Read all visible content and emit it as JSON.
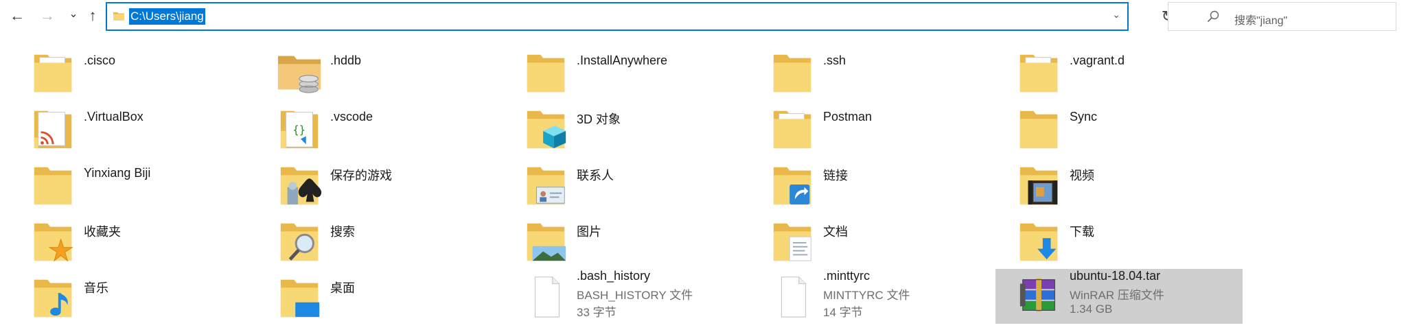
{
  "address": {
    "path": "C:\\Users\\jiang",
    "search_placeholder": "搜索\"jiang\""
  },
  "nav": {
    "back_glyph": "←",
    "forward_glyph": "→",
    "recent_glyph": "⌄",
    "up_glyph": "↑",
    "refresh_glyph": "↻",
    "dropdown_glyph": "⌄"
  },
  "colors": {
    "accent": "#0078d7",
    "folder": "#f8d775",
    "folder_dark": "#e8b84a",
    "selection": "#cfcfcf"
  },
  "items": [
    {
      "name": ".cisco",
      "icon": "folder-doc-icon"
    },
    {
      "name": ".hddb",
      "icon": "folder-database-icon"
    },
    {
      "name": ".InstallAnywhere",
      "icon": "folder-icon"
    },
    {
      "name": ".ssh",
      "icon": "folder-icon"
    },
    {
      "name": ".vagrant.d",
      "icon": "folder-doc-icon"
    },
    {
      "name": ".VirtualBox",
      "icon": "folder-rss-icon"
    },
    {
      "name": ".vscode",
      "icon": "folder-code-icon"
    },
    {
      "name": "3D 对象",
      "icon": "folder-3d-icon"
    },
    {
      "name": "Postman",
      "icon": "folder-doc-icon"
    },
    {
      "name": "Sync",
      "icon": "folder-icon"
    },
    {
      "name": "Yinxiang Biji",
      "icon": "folder-icon"
    },
    {
      "name": "保存的游戏",
      "icon": "folder-games-icon"
    },
    {
      "name": "联系人",
      "icon": "folder-contacts-icon"
    },
    {
      "name": "链接",
      "icon": "folder-links-icon"
    },
    {
      "name": "视频",
      "icon": "folder-videos-icon"
    },
    {
      "name": "收藏夹",
      "icon": "folder-favorites-icon"
    },
    {
      "name": "搜索",
      "icon": "folder-search-icon"
    },
    {
      "name": "图片",
      "icon": "folder-pictures-icon"
    },
    {
      "name": "文档",
      "icon": "folder-documents-icon"
    },
    {
      "name": "下载",
      "icon": "folder-downloads-icon"
    },
    {
      "name": "音乐",
      "icon": "folder-music-icon"
    },
    {
      "name": "桌面",
      "icon": "folder-desktop-icon"
    },
    {
      "name": ".bash_history",
      "icon": "file-icon",
      "type": "BASH_HISTORY 文件",
      "size": "33 字节"
    },
    {
      "name": ".minttyrc",
      "icon": "file-icon",
      "type": "MINTTYRC 文件",
      "size": "14 字节"
    },
    {
      "name": "ubuntu-18.04.tar",
      "icon": "winrar-archive-icon",
      "type": "WinRAR 压缩文件",
      "size": "1.34 GB",
      "selected": true
    }
  ]
}
